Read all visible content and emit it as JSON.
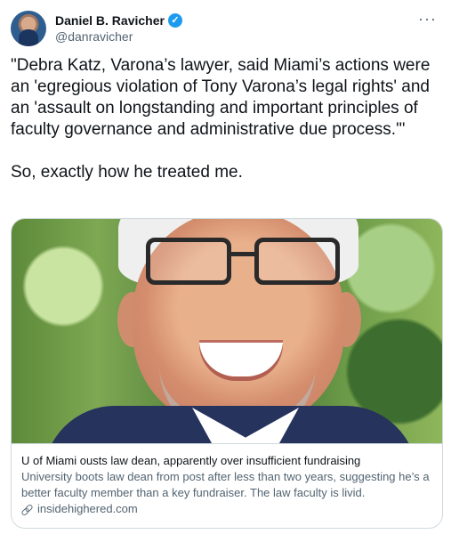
{
  "tweet": {
    "author": {
      "display_name": "Daniel B. Ravicher",
      "handle": "@danravicher",
      "verified_mark": "✓"
    },
    "more_label": "···",
    "text": "\"Debra Katz, Varona’s lawyer, said Miami’s actions were an 'egregious violation of Tony Varona’s legal rights' and an 'assault on longstanding and important principles of faculty governance and administrative due process.'\"\n\nSo, exactly how he treated me."
  },
  "card": {
    "title": "U of Miami ousts law dean, apparently over insufficient fundraising",
    "description": "University boots law dean from post after less than two years, suggesting he’s a better faculty member than a key fundraiser. The law faculty is livid.",
    "domain": "insidehighered.com",
    "image_alt": "Smiling man with glasses in a suit against green foliage"
  },
  "icons": {
    "verified": "verified-icon",
    "more": "more-icon",
    "link": "link-icon"
  },
  "colors": {
    "text": "#0f1419",
    "secondary_text": "#536471",
    "border": "#cfd9de",
    "verified": "#1d9bf0"
  }
}
